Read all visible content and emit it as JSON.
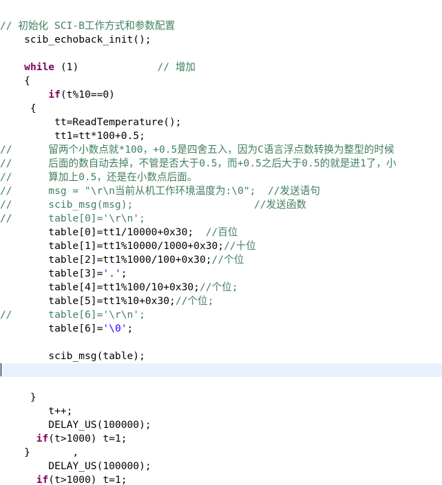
{
  "editor": {
    "colors": {
      "comment": "#3f7f5f",
      "keyword": "#7f0055",
      "string": "#2a00ff",
      "plain": "#000000",
      "current_line": "#e8f2fe"
    },
    "current_line_index": 25,
    "lines": [
      [
        {
          "t": "comment",
          "v": "// 初始化 SCI-B工作方式和参数配置"
        }
      ],
      [
        {
          "t": "plain",
          "v": "    scib_echoback_init();"
        }
      ],
      [],
      [
        {
          "t": "plain",
          "v": "    "
        },
        {
          "t": "keyword",
          "v": "while"
        },
        {
          "t": "plain",
          "v": " (1)             "
        },
        {
          "t": "comment",
          "v": "// 增加"
        }
      ],
      [
        {
          "t": "plain",
          "v": "    {"
        }
      ],
      [
        {
          "t": "plain",
          "v": "        "
        },
        {
          "t": "keyword",
          "v": "if"
        },
        {
          "t": "plain",
          "v": "(t%10==0)"
        }
      ],
      [
        {
          "t": "plain",
          "v": "     {"
        }
      ],
      [
        {
          "t": "plain",
          "v": "         tt=ReadTemperature();"
        }
      ],
      [
        {
          "t": "plain",
          "v": "         tt1=tt*100+0.5;"
        }
      ],
      [
        {
          "t": "comment",
          "v": "//      留两个小数点就*100，+0.5是四舍五入，因为C语言浮点数转换为整型的时候"
        }
      ],
      [
        {
          "t": "comment",
          "v": "//      后面的数自动去掉，不管是否大于0.5，而+0.5之后大于0.5的就是进1了，小"
        }
      ],
      [
        {
          "t": "comment",
          "v": "//      算加上0.5，还是在小数点后面。"
        }
      ],
      [
        {
          "t": "comment",
          "v": "//      msg = \"\\r\\n当前从机工作环境温度为:\\0\";  //发送语句"
        }
      ],
      [
        {
          "t": "comment",
          "v": "//      scib_msg(msg);                    //发送函数"
        }
      ],
      [
        {
          "t": "comment",
          "v": "//      table[0]='\\r\\n';"
        }
      ],
      [
        {
          "t": "plain",
          "v": "        table[0]=tt1/10000+0x30;  "
        },
        {
          "t": "comment",
          "v": "//百位"
        }
      ],
      [
        {
          "t": "plain",
          "v": "        table[1]=tt1%10000/1000+0x30;"
        },
        {
          "t": "comment",
          "v": "//十位"
        }
      ],
      [
        {
          "t": "plain",
          "v": "        table[2]=tt1%1000/100+0x30;"
        },
        {
          "t": "comment",
          "v": "//个位"
        }
      ],
      [
        {
          "t": "plain",
          "v": "        table[3]="
        },
        {
          "t": "string",
          "v": "'.'"
        },
        {
          "t": "plain",
          "v": ";"
        }
      ],
      [
        {
          "t": "plain",
          "v": "        table[4]=tt1%100/10+0x30;"
        },
        {
          "t": "comment",
          "v": "//个位;"
        }
      ],
      [
        {
          "t": "plain",
          "v": "        table[5]=tt1%10+0x30;"
        },
        {
          "t": "comment",
          "v": "//个位;"
        }
      ],
      [
        {
          "t": "comment",
          "v": "//      table[6]='\\r\\n';"
        }
      ],
      [
        {
          "t": "plain",
          "v": "        table[6]="
        },
        {
          "t": "string",
          "v": "'\\0'"
        },
        {
          "t": "plain",
          "v": ";"
        }
      ],
      [],
      [
        {
          "t": "plain",
          "v": "        scib_msg(table);"
        }
      ],
      [],
      [],
      [
        {
          "t": "plain",
          "v": "     }"
        }
      ],
      [
        {
          "t": "plain",
          "v": "        t++;"
        }
      ],
      [
        {
          "t": "plain",
          "v": "        DELAY_US(100000);"
        }
      ],
      [
        {
          "t": "plain",
          "v": "      "
        },
        {
          "t": "keyword",
          "v": "if"
        },
        {
          "t": "plain",
          "v": "(t>1000) t=1;"
        }
      ],
      [
        {
          "t": "plain",
          "v": "    }       ,"
        }
      ],
      [
        {
          "t": "plain",
          "v": "        DELAY_US(100000);"
        }
      ],
      [
        {
          "t": "plain",
          "v": "      "
        },
        {
          "t": "keyword",
          "v": "if"
        },
        {
          "t": "plain",
          "v": "(t>1000) t=1;"
        }
      ],
      [
        {
          "t": "plain",
          "v": "    }"
        }
      ]
    ]
  }
}
